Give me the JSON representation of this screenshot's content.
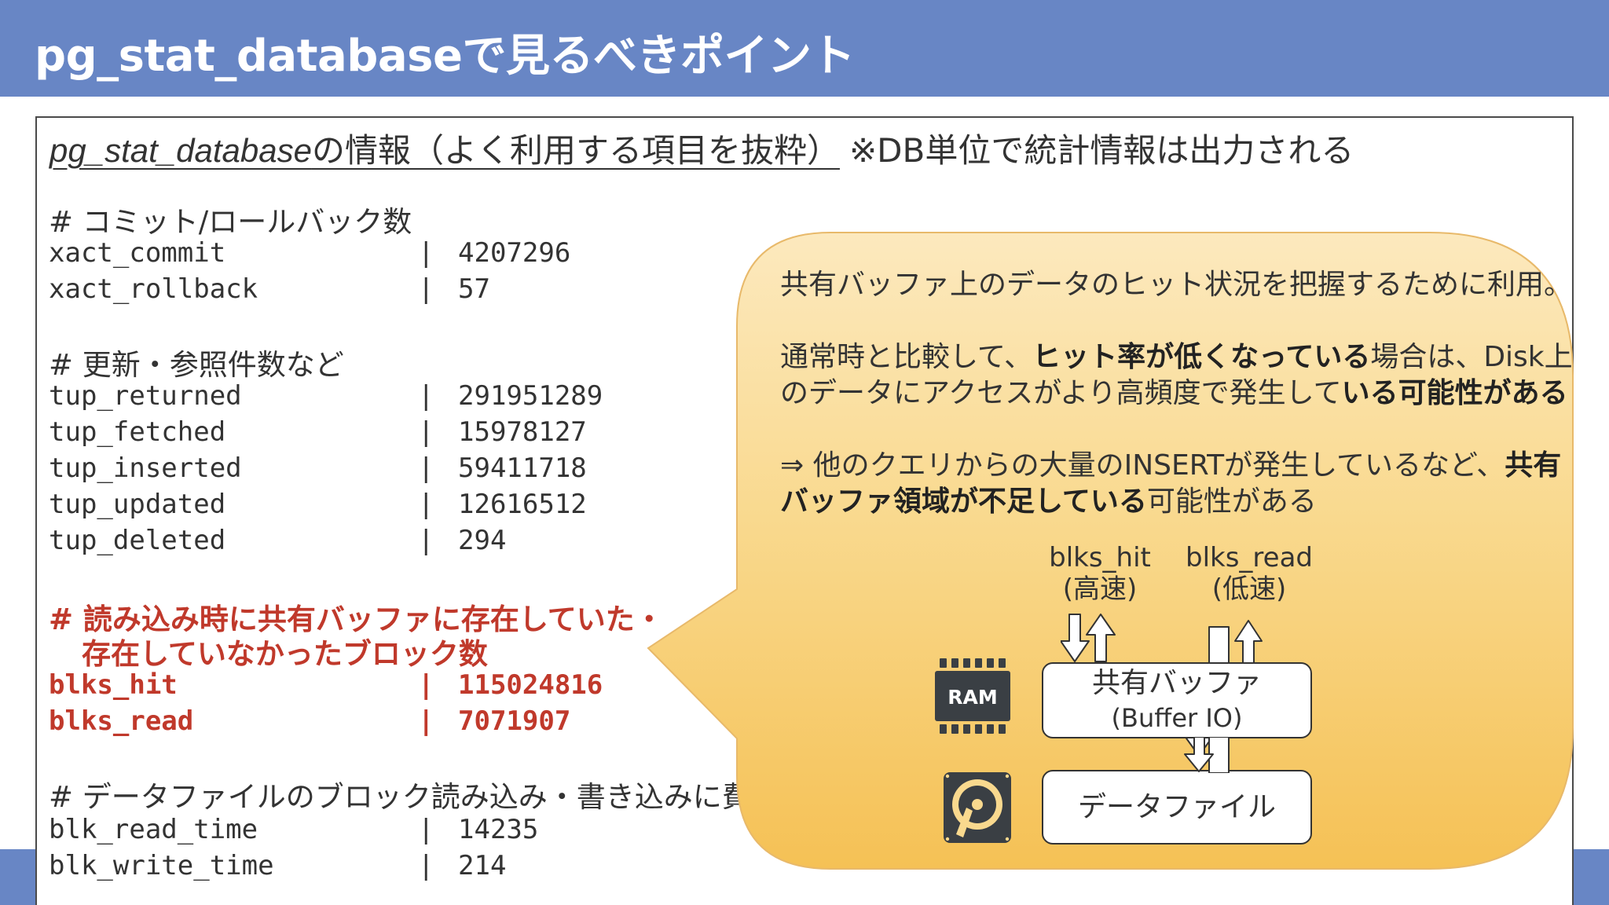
{
  "slide": {
    "title": "pg_stat_databaseで見るべきポイント"
  },
  "panel": {
    "heading_name": "pg_stat_database",
    "heading_rest": "の情報（よく利用する項目を抜粋）",
    "heading_note": "※DB単位で統計情報は出力される"
  },
  "sections": {
    "commit": {
      "comment": "# コミット/ロールバック数",
      "rows": [
        {
          "key": "xact_commit",
          "sep": "|",
          "value": "4207296"
        },
        {
          "key": "xact_rollback",
          "sep": "|",
          "value": "57"
        }
      ]
    },
    "tuples": {
      "comment": "# 更新・参照件数など",
      "rows": [
        {
          "key": "tup_returned",
          "sep": "|",
          "value": "291951289"
        },
        {
          "key": "tup_fetched",
          "sep": "|",
          "value": "15978127"
        },
        {
          "key": "tup_inserted",
          "sep": "|",
          "value": "59411718"
        },
        {
          "key": "tup_updated",
          "sep": "|",
          "value": "12616512"
        },
        {
          "key": "tup_deleted",
          "sep": "|",
          "value": "294"
        }
      ]
    },
    "blocks": {
      "comment_line1": "# 読み込み時に共有バッファに存在していた・",
      "comment_line2": "存在していなかったブロック数",
      "rows": [
        {
          "key": "blks_hit",
          "sep": "|",
          "value": "115024816"
        },
        {
          "key": "blks_read",
          "sep": "|",
          "value": "7071907"
        }
      ]
    },
    "io_time": {
      "comment": "# データファイルのブロック読み込み・書き込みに費やされた合",
      "rows": [
        {
          "key": "blk_read_time",
          "sep": "|",
          "value": "14235"
        },
        {
          "key": "blk_write_time",
          "sep": "|",
          "value": "214"
        }
      ]
    }
  },
  "bubble": {
    "p1": "共有バッファ上のデータのヒット状況を把握するために利用。",
    "p2_a": "通常時と比較して、",
    "p2_b": "ヒット率が低くなっている",
    "p2_c": "場合は、Disk上",
    "p2_d": "のデータにアクセスがより高頻度で発生して",
    "p2_e": "いる可能性がある",
    "p3_a": "⇒ 他のクエリからの大量のINSERTが発生しているなど、",
    "p3_b": "共有",
    "p3_c": "バッファ領域が不足している",
    "p3_d": "可能性がある"
  },
  "diagram": {
    "hit_label": "blks_hit",
    "hit_sub": "(高速)",
    "read_label": "blks_read",
    "read_sub": "(低速)",
    "ram_label": "RAM",
    "buffer_line1": "共有バッファ",
    "buffer_line2": "(Buffer IO)",
    "datafile_label": "データファイル"
  },
  "colors": {
    "title_bar": "#6886C5",
    "highlight_red": "#C0392B",
    "bubble_top": "#FCE9BE",
    "bubble_bottom": "#F6C35B",
    "icon_dark": "#3A3F44"
  },
  "icons": [
    "ram-chip-icon",
    "hard-disk-icon",
    "down-arrow-icon",
    "up-arrow-icon"
  ]
}
